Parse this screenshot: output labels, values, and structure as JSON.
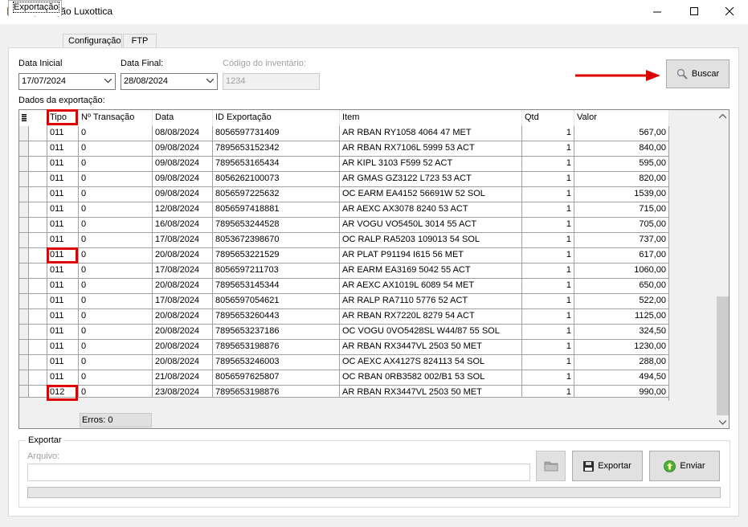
{
  "window": {
    "title": "Exportação Luxottica"
  },
  "tabs": [
    "Exportação",
    "Configuração",
    "FTP"
  ],
  "filters": {
    "data_inicial_label": "Data Inicial",
    "data_inicial_value": "17/07/2024",
    "data_final_label": "Data Final:",
    "data_final_value": "28/08/2024",
    "codigo_label": "Código do inventário:",
    "codigo_placeholder": "1234"
  },
  "buscar_label": "Buscar",
  "grid": {
    "section_label": "Dados da exportação:",
    "columns": [
      "Tipo",
      "Nº Transação",
      "Data",
      "ID Exportação",
      "Item",
      "Qtd",
      "Valor"
    ],
    "rows": [
      [
        "011",
        "0",
        "08/08/2024",
        "8056597731409",
        "AR RBAN RY1058 4064 47 MET",
        "1",
        "567,00"
      ],
      [
        "011",
        "0",
        "09/08/2024",
        "7895653152342",
        "AR RBAN RX7106L 5999 53 ACT",
        "1",
        "840,00"
      ],
      [
        "011",
        "0",
        "09/08/2024",
        "7895653165434",
        "AR KIPL 3103 F599 52 ACT",
        "1",
        "595,00"
      ],
      [
        "011",
        "0",
        "09/08/2024",
        "8056262100073",
        "AR GMAS GZ3122 L723 53 ACT",
        "1",
        "820,00"
      ],
      [
        "011",
        "0",
        "09/08/2024",
        "8056597225632",
        "OC EARM EA4152 56691W 52 SOL",
        "1",
        "1539,00"
      ],
      [
        "011",
        "0",
        "12/08/2024",
        "8056597418881",
        "AR AEXC AX3078 8240 53 ACT",
        "1",
        "715,00"
      ],
      [
        "011",
        "0",
        "16/08/2024",
        "7895653244528",
        "AR VOGU VO5450L 3014 55 ACT",
        "1",
        "705,00"
      ],
      [
        "011",
        "0",
        "17/08/2024",
        "8053672398670",
        "OC RALP RA5203 109013 54 SOL",
        "1",
        "737,00"
      ],
      [
        "011",
        "0",
        "20/08/2024",
        "7895653221529",
        "AR PLAT P91194 I615 56 MET",
        "1",
        "617,00"
      ],
      [
        "011",
        "0",
        "17/08/2024",
        "8056597211703",
        "AR EARM EA3169 5042 55 ACT",
        "1",
        "1060,00"
      ],
      [
        "011",
        "0",
        "20/08/2024",
        "7895653145344",
        "AR AEXC AX1019L 6089 54 MET",
        "1",
        "650,00"
      ],
      [
        "011",
        "0",
        "17/08/2024",
        "8056597054621",
        "AR RALP RA7110 5776 52 ACT",
        "1",
        "522,00"
      ],
      [
        "011",
        "0",
        "20/08/2024",
        "7895653260443",
        "AR RBAN RX7220L 8279 54 ACT",
        "1",
        "1125,00"
      ],
      [
        "011",
        "0",
        "20/08/2024",
        "7895653237186",
        "OC VOGU 0VO5428SL W44/87 55 SOL",
        "1",
        "324,50"
      ],
      [
        "011",
        "0",
        "20/08/2024",
        "7895653198876",
        "AR RBAN RX3447VL 2503 50 MET",
        "1",
        "1230,00"
      ],
      [
        "011",
        "0",
        "20/08/2024",
        "7895653246003",
        "OC AEXC AX4127S 824113 54 SOL",
        "1",
        "288,00"
      ],
      [
        "011",
        "0",
        "21/08/2024",
        "8056597625807",
        "OC RBAN 0RB3582 002/B1 53 SOL",
        "1",
        "494,50"
      ],
      [
        "012",
        "0",
        "23/08/2024",
        "7895653198876",
        "AR RBAN RX3447VL 2503 50 MET",
        "1",
        "990,00"
      ]
    ],
    "errors_text": "Erros: 0"
  },
  "export": {
    "group_title": "Exportar",
    "arquivo_label": "Arquivo:",
    "arquivo_value": "",
    "exportar_label": "Exportar",
    "enviar_label": "Enviar"
  },
  "colors": {
    "highlight_red": "#e00000",
    "arrow_red": "#e00000"
  }
}
